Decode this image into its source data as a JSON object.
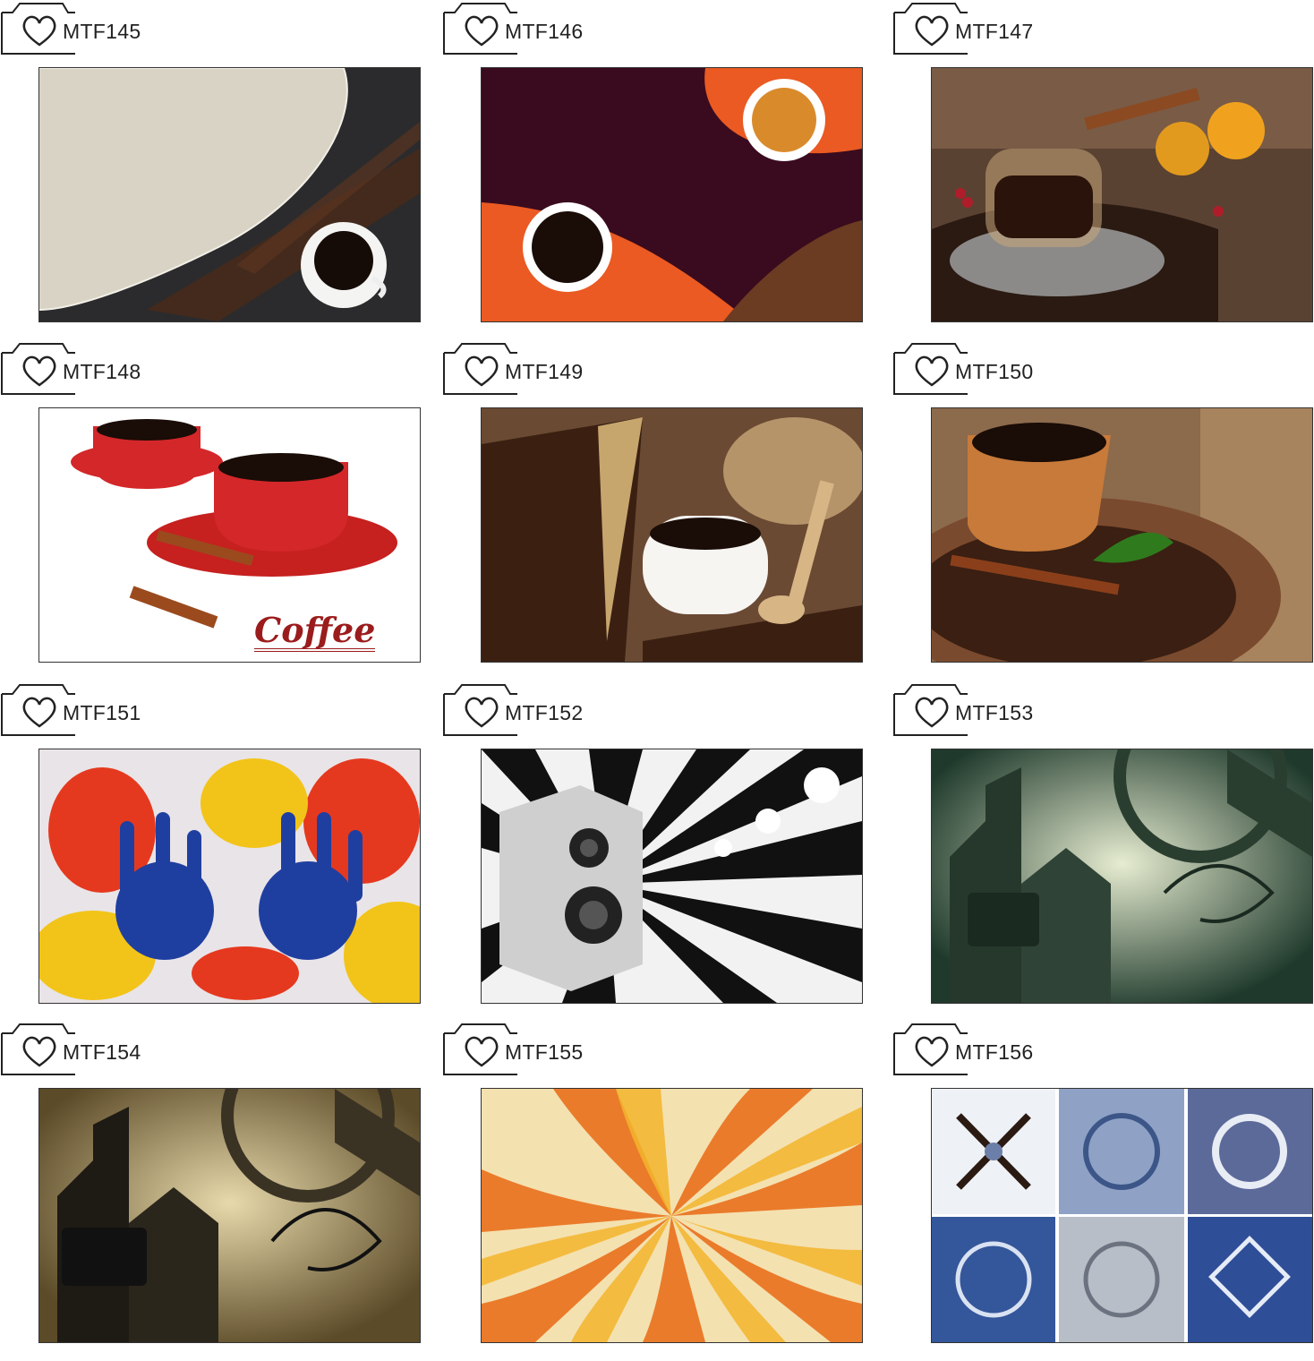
{
  "tiles": [
    {
      "code": "MTF145",
      "image": "coffee-cup-beans-slate-canvas"
    },
    {
      "code": "MTF146",
      "image": "two-coffee-cups-orange-plum"
    },
    {
      "code": "MTF147",
      "image": "espresso-cinnamon-orange-slices"
    },
    {
      "code": "MTF148",
      "image": "red-coffee-cups-cinnamon",
      "caption": "Coffee"
    },
    {
      "code": "MTF149",
      "image": "coffee-cup-beans-sack-spoon"
    },
    {
      "code": "MTF150",
      "image": "clay-cup-cinnamon-plate"
    },
    {
      "code": "MTF151",
      "image": "painted-handprints"
    },
    {
      "code": "MTF152",
      "image": "speaker-black-white-swirl"
    },
    {
      "code": "MTF153",
      "image": "green-city-floral-grunge"
    },
    {
      "code": "MTF154",
      "image": "sepia-city-floral-grunge"
    },
    {
      "code": "MTF155",
      "image": "orange-yellow-spiral-rays"
    },
    {
      "code": "MTF156",
      "image": "blue-patterned-tiles"
    }
  ],
  "colors": {
    "frame_border": "#333333",
    "label_text": "#222222",
    "coffee_caption": "#9b1c1c"
  }
}
